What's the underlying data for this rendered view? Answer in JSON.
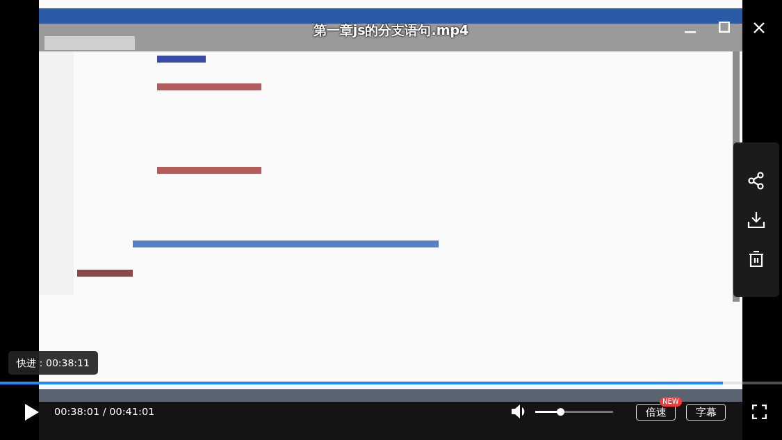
{
  "title": "第一章js的分支语句.mp4",
  "seek_tooltip": "快进：00:38:11",
  "progress": {
    "level": 0.924
  },
  "playing": false,
  "time": "00:38:01 / 00:41:01",
  "volume": {
    "muted": false,
    "level": 0.32
  },
  "buttons": [
    {
      "label": "倍速",
      "badge": "NEW"
    },
    {
      "label": "字幕"
    }
  ]
}
